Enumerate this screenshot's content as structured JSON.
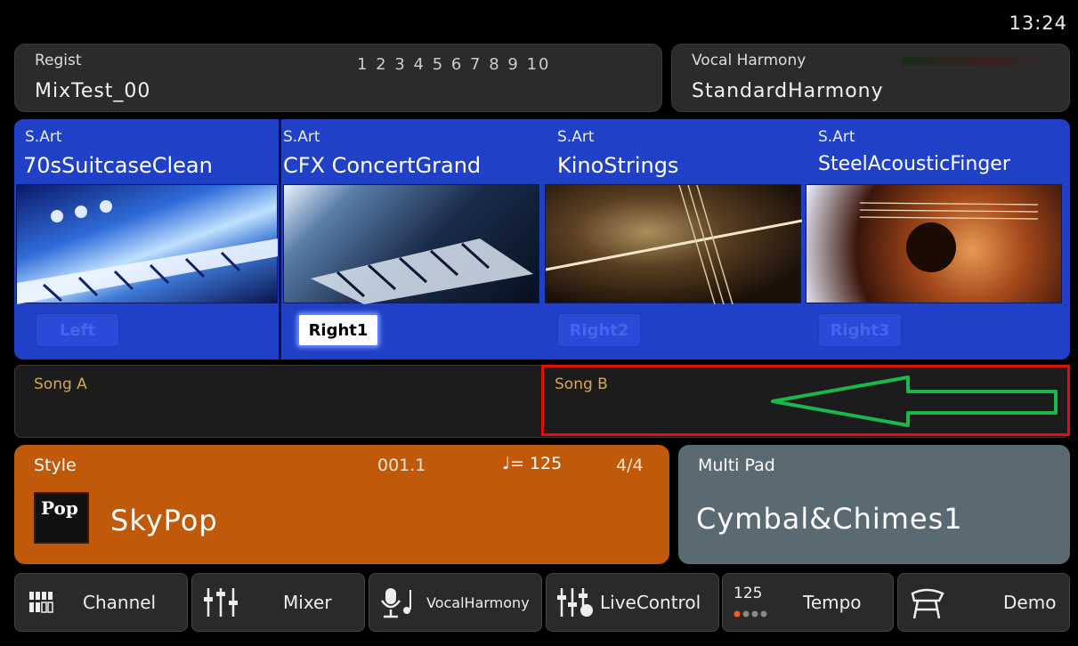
{
  "clock": "13:24",
  "regist": {
    "label": "Regist",
    "name": "MixTest_00",
    "numbers": "1 2 3 4 5 6 7 8 9 10"
  },
  "vocal": {
    "label": "Vocal Harmony",
    "name": "StandardHarmony"
  },
  "voices": [
    {
      "type": "S.Art",
      "name": "70sSuitcaseClean",
      "part": "Left",
      "active": false
    },
    {
      "type": "S.Art",
      "name": "CFX ConcertGrand",
      "part": "Right1",
      "active": true
    },
    {
      "type": "S.Art",
      "name": "KinoStrings",
      "part": "Right2",
      "active": false
    },
    {
      "type": "S.Art",
      "name": "SteelAcousticFinger",
      "part": "Right3",
      "active": false
    }
  ],
  "song": {
    "a_label": "Song A",
    "b_label": "Song B"
  },
  "style": {
    "label": "Style",
    "number": "001.1",
    "tempo": "♩= 125",
    "time_sig": "4/4",
    "name": "SkyPop",
    "badge": "Pop"
  },
  "multipad": {
    "label": "Multi Pad",
    "name": "Cymbal&Chimes1"
  },
  "bottom": {
    "channel": "Channel",
    "mixer": "Mixer",
    "vocalharmony": "VocalHarmony",
    "livecontrol": "LiveControl",
    "tempo_value": "125",
    "tempo": "Tempo",
    "demo": "Demo"
  },
  "colors": {
    "voice_bg": "#2040c8",
    "style_bg": "#c05a0a",
    "pad_bg": "#5a6a72",
    "highlight_box": "#e01010",
    "arrow": "#19b84a"
  }
}
